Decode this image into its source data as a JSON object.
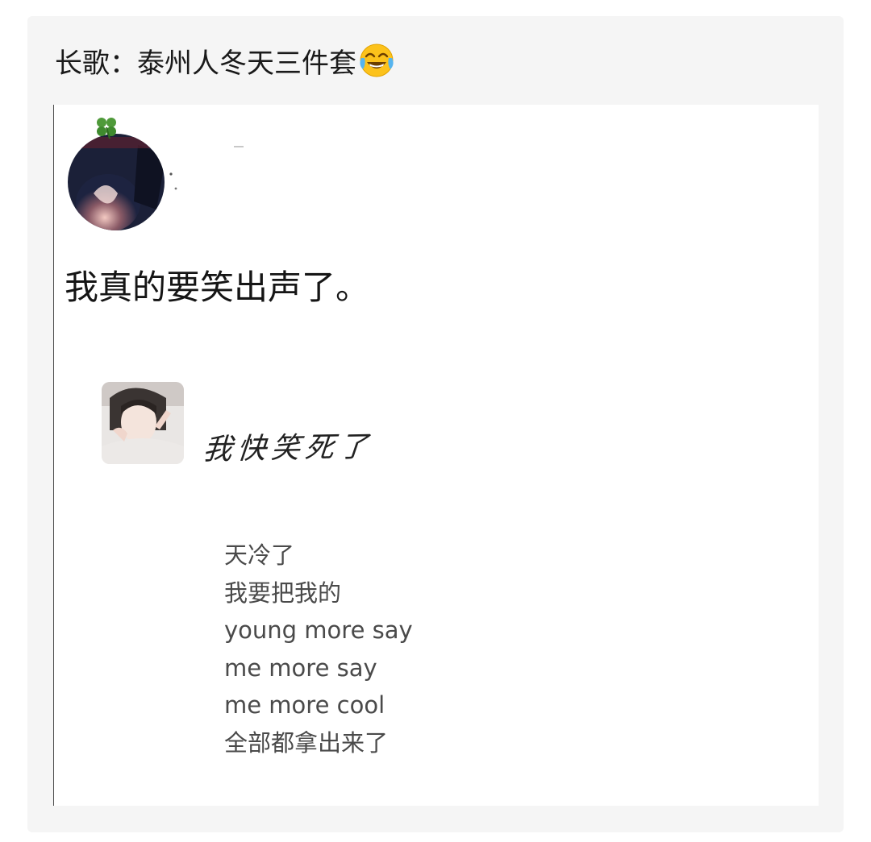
{
  "post": {
    "title": "长歌：泰州人冬天三件套",
    "emoji_icon": "tears-of-joy-emoji-icon"
  },
  "screenshot": {
    "main_text": "我真的要笑出声了。",
    "handwritten_text": "我快笑死了",
    "lyrics": [
      "天冷了",
      "我要把我的",
      "young more say",
      "me more say",
      "me more cool",
      "全部都拿出来了"
    ]
  },
  "colors": {
    "card_bg": "#f5f5f5",
    "lyrics_text": "#4a4a4a"
  }
}
